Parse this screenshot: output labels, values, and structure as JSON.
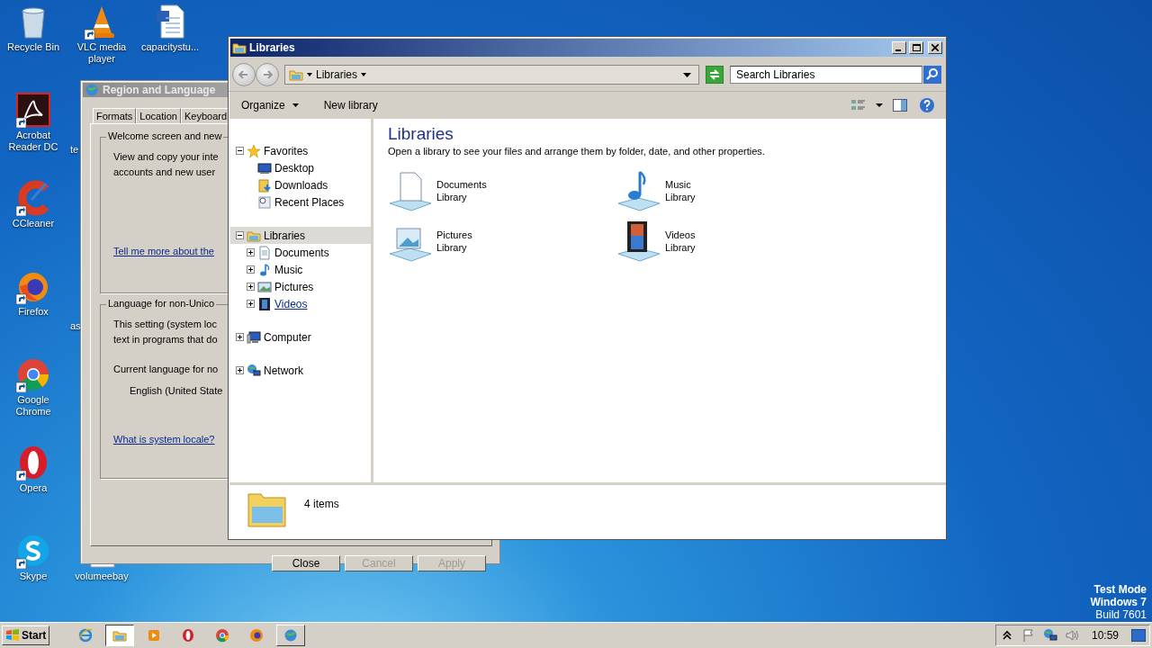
{
  "desktop_columns": [
    [
      {
        "label": "Recycle Bin",
        "kind": "recycle",
        "shortcut": false
      },
      {
        "label": "Acrobat Reader DC",
        "kind": "acrobat",
        "shortcut": true
      },
      {
        "label": "CCleaner",
        "kind": "ccleaner",
        "shortcut": true
      },
      {
        "label": "Firefox",
        "kind": "firefox",
        "shortcut": true
      },
      {
        "label": "Google Chrome",
        "kind": "chrome",
        "shortcut": true
      },
      {
        "label": "Opera",
        "kind": "opera",
        "shortcut": true
      },
      {
        "label": "Skype",
        "kind": "skype",
        "shortcut": true
      }
    ],
    [
      {
        "label": "VLC media player",
        "kind": "vlc",
        "shortcut": true
      },
      {
        "label": "te",
        "kind": "covered"
      },
      {
        "kind": "empty"
      },
      {
        "label": "as",
        "kind": "covered"
      },
      {
        "kind": "empty"
      },
      {
        "kind": "empty"
      },
      {
        "label": "volumeebay",
        "kind": "file",
        "shortcut": false
      }
    ],
    [
      {
        "label": "capacitystu...",
        "kind": "word",
        "shortcut": false
      }
    ]
  ],
  "region_dialog": {
    "title": "Region and Language",
    "tabs": [
      {
        "label": "Formats",
        "selected": false
      },
      {
        "label": "Location",
        "selected": false
      },
      {
        "label": "Keyboard",
        "selected": false
      }
    ],
    "groups": [
      {
        "title": "Welcome screen and new",
        "lines": [
          "View and copy your inte",
          "accounts and new user"
        ],
        "link": "Tell me more about the"
      },
      {
        "title": "Language for non-Unico",
        "lines": [
          "This setting (system loc",
          "text in programs that do"
        ],
        "current": "Current language for no",
        "value": "English (United State",
        "link": "What is system locale?"
      }
    ],
    "buttons": [
      {
        "label": "Close",
        "disabled": false
      },
      {
        "label": "Cancel",
        "disabled": true
      },
      {
        "label": "Apply",
        "disabled": true
      }
    ]
  },
  "explorer": {
    "title": "Libraries",
    "address": [
      "Libraries"
    ],
    "search": {
      "placeholder": "Search Libraries"
    },
    "toolbar": [
      {
        "label": "Organize",
        "dropdown": true
      },
      {
        "label": "New library",
        "dropdown": false
      }
    ],
    "nav": [
      {
        "label": "Favorites",
        "kind": "star",
        "expanded": true,
        "selected": false,
        "children": [
          {
            "label": "Desktop",
            "kind": "desktop",
            "selected": false
          },
          {
            "label": "Downloads",
            "kind": "downloads",
            "selected": false
          },
          {
            "label": "Recent Places",
            "kind": "recent",
            "selected": false
          }
        ]
      },
      {
        "label": "Libraries",
        "kind": "library",
        "expanded": true,
        "selected": true,
        "children": [
          {
            "label": "Documents",
            "kind": "documents",
            "expanded": false,
            "selected": false,
            "hovered": false
          },
          {
            "label": "Music",
            "kind": "music",
            "expanded": false,
            "selected": false,
            "hovered": false
          },
          {
            "label": "Pictures",
            "kind": "pictures",
            "expanded": false,
            "selected": false,
            "hovered": false
          },
          {
            "label": "Videos",
            "kind": "videos",
            "expanded": false,
            "selected": false,
            "hovered": true
          }
        ]
      },
      {
        "label": "Computer",
        "kind": "computer",
        "expanded": false,
        "selected": false
      },
      {
        "label": "Network",
        "kind": "network",
        "expanded": false,
        "selected": false
      }
    ],
    "heading": "Libraries",
    "description": "Open a library to see your files and arrange them by folder, date, and other properties.",
    "libraries": [
      {
        "name": "Documents",
        "sub": "Library",
        "kind": "documents"
      },
      {
        "name": "Music",
        "sub": "Library",
        "kind": "music"
      },
      {
        "name": "Pictures",
        "sub": "Library",
        "kind": "pictures"
      },
      {
        "name": "Videos",
        "sub": "Library",
        "kind": "videos"
      }
    ],
    "details": "4 items"
  },
  "watermark_text": [
    "Test Mode",
    "Windows 7",
    "Build 7601"
  ],
  "taskbar": {
    "start": "Start",
    "items": [
      {
        "kind": "ie",
        "selected": false,
        "running": false
      },
      {
        "kind": "explorer",
        "selected": true,
        "running": true
      },
      {
        "kind": "media",
        "selected": false,
        "running": false
      },
      {
        "kind": "opera",
        "selected": false,
        "running": false
      },
      {
        "kind": "chrome",
        "selected": false,
        "running": false
      },
      {
        "kind": "firefox",
        "selected": false,
        "running": false
      },
      {
        "kind": "globe",
        "selected": false,
        "running": true
      }
    ],
    "tray": [
      {
        "kind": "chevron"
      },
      {
        "kind": "flag"
      },
      {
        "kind": "network"
      },
      {
        "kind": "speaker"
      }
    ],
    "clock": "10:59"
  }
}
